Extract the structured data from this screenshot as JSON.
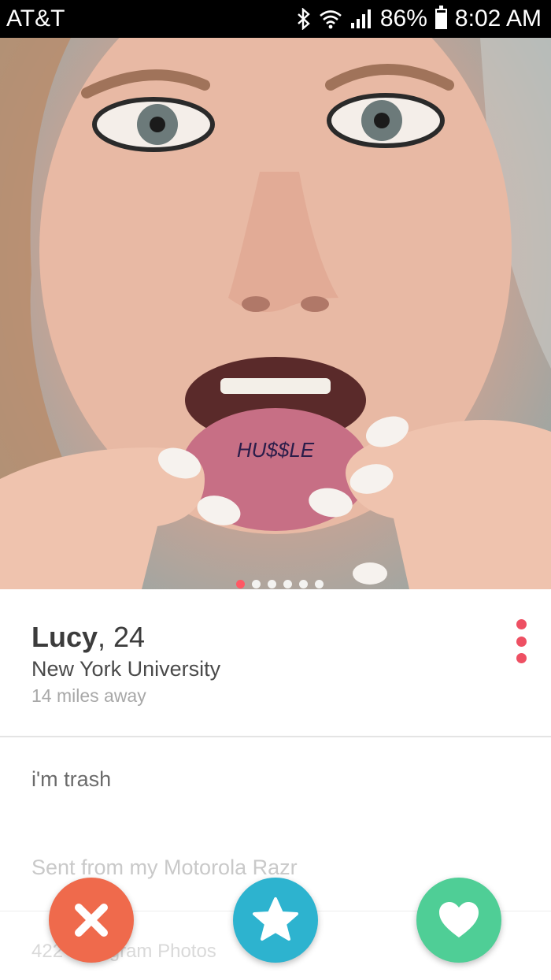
{
  "status_bar": {
    "carrier": "AT&T",
    "battery": "86%",
    "battery_level": 0.86,
    "time": "8:02 AM",
    "icons": [
      "bluetooth-icon",
      "wifi-icon",
      "signal-icon",
      "battery-icon"
    ]
  },
  "photo": {
    "tattoo_text": "HU$$LE",
    "photo_count": 6,
    "active_index": 0
  },
  "profile": {
    "name": "Lucy",
    "age": ", 24",
    "school": "New York University",
    "distance": "14 miles away"
  },
  "bio": {
    "line1": "i'm trash",
    "line2": "Sent from my Motorola Razr"
  },
  "instagram": {
    "label": "422 Instagram Photos"
  },
  "actions": {
    "nope": "close-icon",
    "super_like": "star-icon",
    "like": "heart-icon"
  },
  "colors": {
    "accent": "#ff5864",
    "nope": "#ef6a4c",
    "super_like": "#2db3cf",
    "like": "#4fce96",
    "menu": "#ee5063"
  }
}
